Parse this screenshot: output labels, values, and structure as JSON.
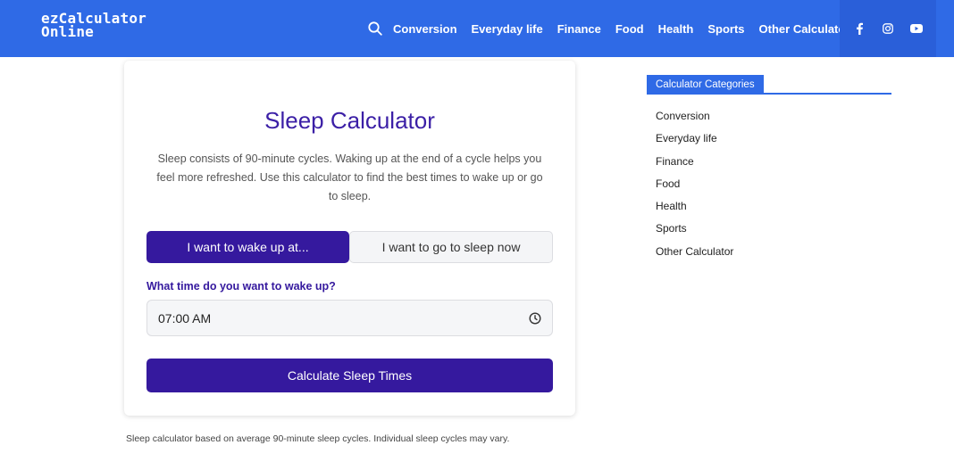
{
  "header": {
    "logo_line1": "ezCalculator",
    "logo_line2": "Online",
    "nav": [
      "Conversion",
      "Everyday life",
      "Finance",
      "Food",
      "Health",
      "Sports",
      "Other Calculator"
    ],
    "social_icons": [
      "facebook-icon",
      "instagram-icon",
      "youtube-icon"
    ],
    "brand_color": "#2f6ae6"
  },
  "calculator": {
    "title": "Sleep Calculator",
    "description": "Sleep consists of 90-minute cycles. Waking up at the end of a cycle helps you feel more refreshed. Use this calculator to find the best times to wake up or go to sleep.",
    "tab_wake": "I want to wake up at...",
    "tab_sleep": "I want to go to sleep now",
    "question": "What time do you want to wake up?",
    "time_value": "07:00 AM",
    "button_label": "Calculate Sleep Times",
    "accent_color": "#35199e"
  },
  "footnote": "Sleep calculator based on average 90-minute sleep cycles. Individual sleep cycles may vary.",
  "sidebar": {
    "heading": "Calculator Categories",
    "items": [
      "Conversion",
      "Everyday life",
      "Finance",
      "Food",
      "Health",
      "Sports",
      "Other Calculator"
    ]
  }
}
